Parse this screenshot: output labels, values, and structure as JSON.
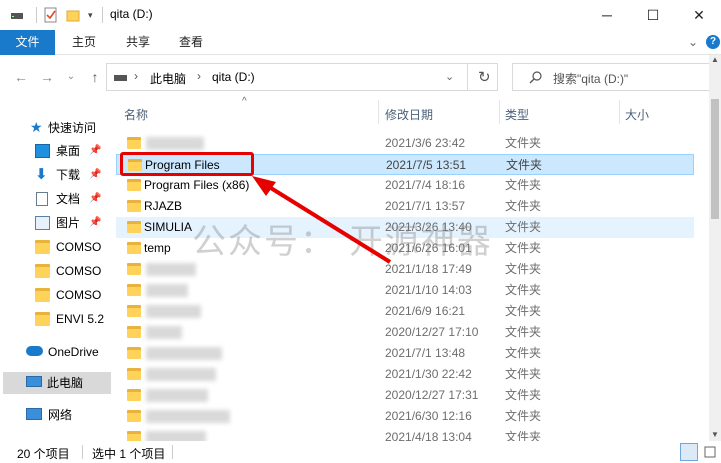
{
  "window": {
    "title": "qita (D:)",
    "minimize_glyph": "─",
    "maximize_glyph": "☐",
    "close_glyph": "✕"
  },
  "ribbon": {
    "tabs": [
      {
        "label": "文件"
      },
      {
        "label": "主页"
      },
      {
        "label": "共享"
      },
      {
        "label": "查看"
      }
    ],
    "expand_glyph": "⌄",
    "help_glyph": "?"
  },
  "nav": {
    "back_glyph": "←",
    "forward_glyph": "→",
    "recent_glyph": "⌄",
    "up_glyph": "↑",
    "breadcrumb": [
      "此电脑",
      "qita (D:)"
    ],
    "sep_glyph": "›",
    "refresh_glyph": "↻",
    "search_placeholder": "搜索\"qita (D:)\""
  },
  "sidebar": {
    "quick_access": "快速访问",
    "items": [
      {
        "label": "桌面",
        "icon": "desktop-icon"
      },
      {
        "label": "下载",
        "icon": "download-icon"
      },
      {
        "label": "文档",
        "icon": "documents-icon"
      },
      {
        "label": "图片",
        "icon": "pictures-icon"
      },
      {
        "label": "COMSO",
        "icon": "folder-icon"
      },
      {
        "label": "COMSO",
        "icon": "folder-icon"
      },
      {
        "label": "COMSO",
        "icon": "folder-icon"
      },
      {
        "label": "ENVI 5.2",
        "icon": "folder-icon"
      }
    ],
    "onedrive": "OneDrive",
    "this_pc": "此电脑",
    "network": "网络"
  },
  "columns": {
    "name": "名称",
    "date": "修改日期",
    "type": "类型",
    "size": "大小"
  },
  "files": [
    {
      "name": "",
      "date": "2021/3/6 23:42",
      "type": "文件夹"
    },
    {
      "name": "Program Files",
      "date": "2021/7/5 13:51",
      "type": "文件夹",
      "selected": true
    },
    {
      "name": "Program Files (x86)",
      "date": "2021/7/4 18:16",
      "type": "文件夹"
    },
    {
      "name": "RJAZB",
      "date": "2021/7/1 13:57",
      "type": "文件夹"
    },
    {
      "name": "SIMULIA",
      "date": "2021/3/26 13:40",
      "type": "文件夹"
    },
    {
      "name": "temp",
      "date": "2021/6/26 16:01",
      "type": "文件夹"
    },
    {
      "name": "",
      "date": "2021/1/18 17:49",
      "type": "文件夹"
    },
    {
      "name": "",
      "date": "2021/1/10 14:03",
      "type": "文件夹"
    },
    {
      "name": "",
      "date": "2021/6/9 16:21",
      "type": "文件夹"
    },
    {
      "name": "",
      "date": "2020/12/27 17:10",
      "type": "文件夹"
    },
    {
      "name": "",
      "date": "2021/7/1 13:48",
      "type": "文件夹"
    },
    {
      "name": "",
      "date": "2021/1/30 22:42",
      "type": "文件夹"
    },
    {
      "name": "",
      "date": "2020/12/27 17:31",
      "type": "文件夹"
    },
    {
      "name": "",
      "date": "2021/6/30 12:16",
      "type": "文件夹"
    },
    {
      "name": "",
      "date": "2021/4/18 13:04",
      "type": "文件夹"
    }
  ],
  "status": {
    "count": "20 个项目",
    "selected": "选中 1 个项目"
  },
  "watermark": "公众号：  开源神器",
  "colors": {
    "accent": "#1979ca",
    "selection": "#cce8ff",
    "highlight": "#e60000"
  }
}
